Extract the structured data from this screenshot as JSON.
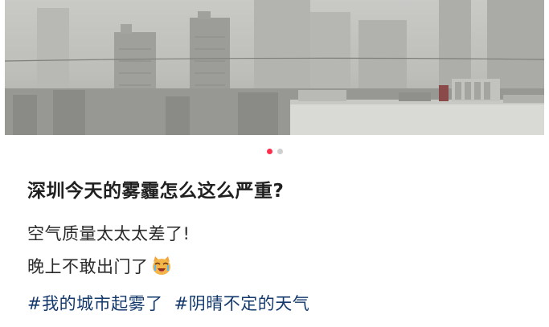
{
  "post": {
    "title": "深圳今天的雾霾怎么这么严重?",
    "body_line1": "空气质量太太太差了!",
    "body_line2": "晚上不敢出门了",
    "emoji_icon": "crying-cat-emoji-icon",
    "tags": [
      "#我的城市起雾了",
      "#阴晴不定的天气"
    ]
  },
  "carousel": {
    "total": 2,
    "active_index": 0,
    "active_color": "#ff2e4d",
    "inactive_color": "#cfcfcf"
  },
  "colors": {
    "tag": "#13386c",
    "title": "#202020"
  }
}
